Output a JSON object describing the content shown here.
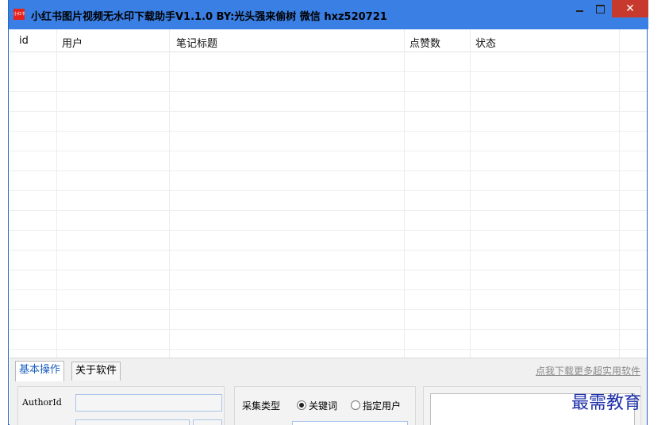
{
  "window": {
    "icon_text": "小红书",
    "title": "小红书图片视频无水印下载助手V1.1.0  BY:光头强来偷树  微信 hxz520721",
    "close_glyph": "✕"
  },
  "table": {
    "columns": [
      "id",
      "用户",
      "笔记标题",
      "点赞数",
      "状态"
    ]
  },
  "tabs": {
    "items": [
      "基本操作",
      "关于软件"
    ],
    "active": "基本操作",
    "link": "点我下载更多超实用软件"
  },
  "form": {
    "author_label": "AuthorId",
    "collect_type_label": "采集类型",
    "options": [
      "关键词",
      "指定用户"
    ],
    "selected_option": "关键词"
  },
  "watermark": "最需教育",
  "colors": {
    "titlebar": "#3a7fe4",
    "close_button": "#c7392d",
    "active_tab_text": "#1b5fc1",
    "watermark": "#1c2ea8"
  }
}
